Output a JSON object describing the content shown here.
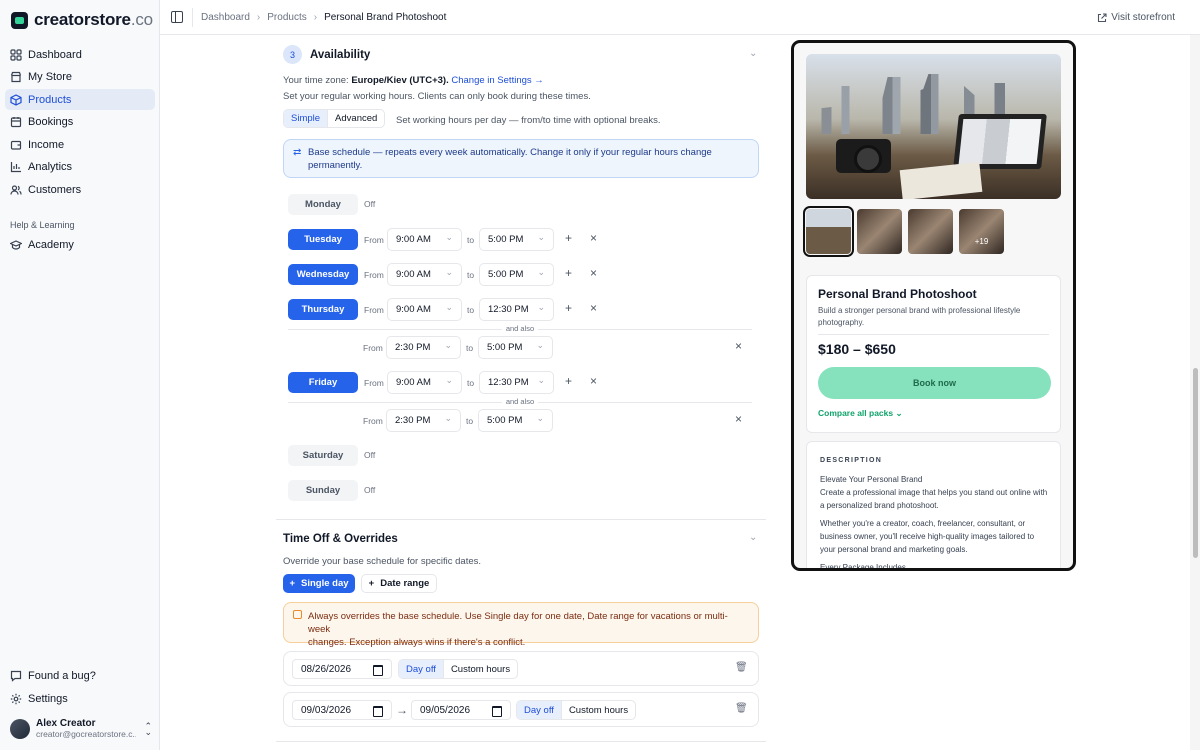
{
  "app": {
    "logo_name": "creatorstore",
    "logo_tld": ".co"
  },
  "sidebar": {
    "items": [
      {
        "label": "Dashboard",
        "icon": "grid-icon"
      },
      {
        "label": "My Store",
        "icon": "store-icon"
      },
      {
        "label": "Products",
        "icon": "box-icon",
        "active": true
      },
      {
        "label": "Bookings",
        "icon": "calendar-icon"
      },
      {
        "label": "Income",
        "icon": "wallet-icon"
      },
      {
        "label": "Analytics",
        "icon": "chart-icon"
      },
      {
        "label": "Customers",
        "icon": "users-icon"
      }
    ],
    "section_help": "Help & Learning",
    "academy": "Academy",
    "bug": "Found a bug?",
    "settings": "Settings",
    "user_name": "Alex Creator",
    "user_email": "creator@gocreatorstore.c..."
  },
  "topbar": {
    "crumbs": [
      "Dashboard",
      "Products",
      "Personal Brand Photoshoot"
    ],
    "visit": "Visit storefront"
  },
  "availability": {
    "step": "3",
    "title": "Availability",
    "tz_label": "Your time zone:",
    "tz_value": "Europe/Kiev (UTC+3).",
    "tz_link": "Change in Settings →",
    "note": "Set your regular working hours. Clients can only book during these times.",
    "mode_simple": "Simple",
    "mode_advanced": "Advanced",
    "mode_help": "Set working hours per day — from/to time with optional breaks.",
    "info_line1": "Base schedule — repeats every week automatically. Change it only if your regular hours change",
    "info_line2": "permanently.",
    "from": "From",
    "to": "to",
    "off": "Off",
    "and_also": "and also",
    "days": {
      "monday": "Monday",
      "tuesday": "Tuesday",
      "wednesday": "Wednesday",
      "thursday": "Thursday",
      "friday": "Friday",
      "saturday": "Saturday",
      "sunday": "Sunday"
    },
    "times": {
      "t900": "9:00 AM",
      "t500": "5:00 PM",
      "t1230": "12:30 PM",
      "t230": "2:30 PM"
    }
  },
  "timeoff": {
    "title": "Time Off & Overrides",
    "note": "Override your base schedule for specific dates.",
    "single_day": "Single day",
    "date_range": "Date range",
    "warn_line1": "Always overrides the base schedule. Use Single day for one date, Date range for vacations or multi-week",
    "warn_line2": "changes. Exception always wins if there's a conflict.",
    "day_off": "Day off",
    "custom_hours": "Custom hours",
    "date1": "08/26/2026",
    "range_start": "09/03/2026",
    "range_end": "09/05/2026",
    "arrow": "→"
  },
  "preview": {
    "thumb_more": "+19",
    "title": "Personal Brand Photoshoot",
    "subtitle": "Build a stronger personal brand with professional lifestyle photography.",
    "price": "$180 – $650",
    "book": "Book now",
    "compare": "Compare all packs ⌄",
    "desc_heading": "DESCRIPTION",
    "desc_title": "Elevate Your Personal Brand",
    "desc_p1": "Create a professional image that helps you stand out online with a personalized brand photoshoot.",
    "desc_p2": "Whether you're a creator, coach, freelancer, consultant, or business owner, you'll receive high-quality images tailored to your personal brand and marketing goals.",
    "desc_p3": "Every Package Includes"
  },
  "colors": {
    "primary": "#2563eb",
    "mint": "#86e2bd"
  }
}
